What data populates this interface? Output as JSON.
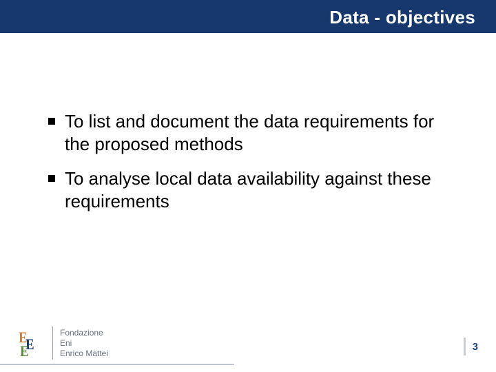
{
  "header": {
    "title": "Data - objectives"
  },
  "bullets": [
    {
      "text": "To list and document the data requirements for the proposed methods"
    },
    {
      "text": "To analyse local data availability against these requirements"
    }
  ],
  "footer": {
    "logo": {
      "line1": "Fondazione",
      "line2": "Eni",
      "line3": "Enrico Mattei"
    },
    "page_number": "3"
  }
}
